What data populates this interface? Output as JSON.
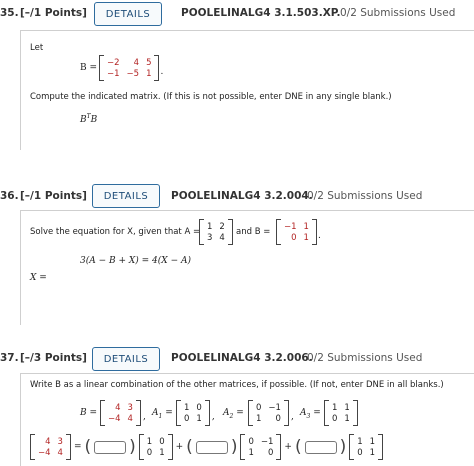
{
  "q35": {
    "number": "35.",
    "points": "[–/1 Points]",
    "details": "DETAILS",
    "code": "POOLELINALG4 3.1.503.XP.",
    "submissions": "0/2 Submissions Used",
    "let": "Let",
    "b_label": "B =",
    "matrix_b": [
      [
        "−2",
        "4",
        "5"
      ],
      [
        "−1",
        "−5",
        "1"
      ]
    ],
    "period": ".",
    "instruction": "Compute the indicated matrix. (If this is not possible, enter DNE in any single blank.)",
    "expr_b": "B",
    "expr_t": "T",
    "expr_b2": "B"
  },
  "q36": {
    "number": "36.",
    "points": "[–/1 Points]",
    "details": "DETAILS",
    "code": "POOLELINALG4 3.2.004.",
    "submissions": "0/2 Submissions Used",
    "instruction": "Solve the equation for X, given that A =",
    "matrix_a": [
      [
        "1",
        "2"
      ],
      [
        "3",
        "4"
      ]
    ],
    "and_b": "and B =",
    "matrix_b": [
      [
        "−1",
        "1"
      ],
      [
        "0",
        "1"
      ]
    ],
    "period": ".",
    "equation": "3(A − B + X) = 4(X − A)",
    "x_label": "X ="
  },
  "q37": {
    "number": "37.",
    "points": "[–/3 Points]",
    "details": "DETAILS",
    "code": "POOLELINALG4 3.2.006.",
    "submissions": "0/2 Submissions Used",
    "instruction": "Write B as a linear combination of the other matrices, if possible. (If not, enter DNE in all blanks.)",
    "b_label": "B =",
    "matrix_b": [
      [
        "4",
        "3"
      ],
      [
        "−4",
        "4"
      ]
    ],
    "a1_label": "A",
    "a1_sub": "1",
    "matrix_a1": [
      [
        "1",
        "0"
      ],
      [
        "0",
        "1"
      ]
    ],
    "a2_label": "A",
    "a2_sub": "2",
    "matrix_a2": [
      [
        "0",
        "−1"
      ],
      [
        "1",
        "0"
      ]
    ],
    "a3_label": "A",
    "a3_sub": "3",
    "matrix_a3": [
      [
        "1",
        "1"
      ],
      [
        "0",
        "1"
      ]
    ],
    "eq": "=",
    "plus": "+",
    "open_paren": "(",
    "close_paren": ")",
    "comma": ",",
    "period": "."
  }
}
